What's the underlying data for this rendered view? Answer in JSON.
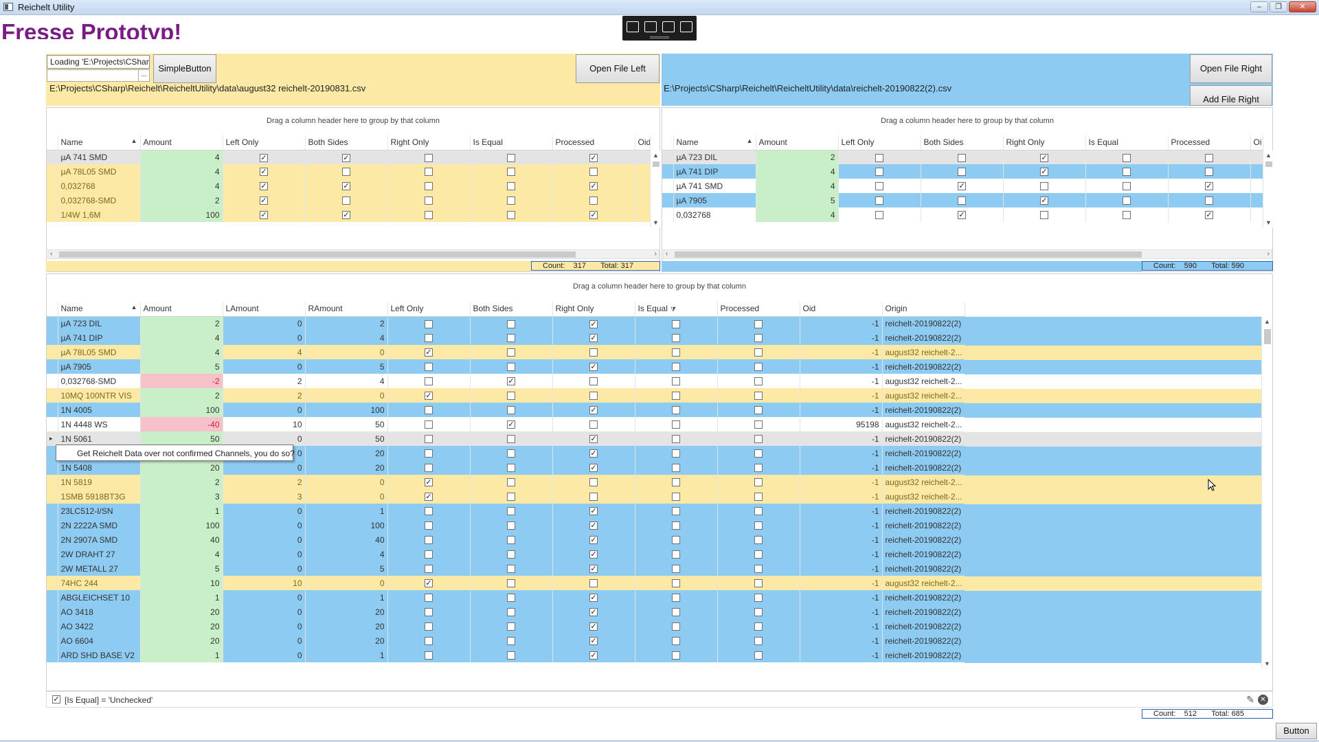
{
  "window": {
    "title": "Reichelt Utility"
  },
  "heading": "Fresse  Prototyp!",
  "left_panel": {
    "loading_text": "Loading 'E:\\Projects\\CSharp",
    "ellipsis": "...",
    "simple_button": "SimpleButton",
    "open_button": "Open File Left",
    "path": "E:\\Projects\\CSharp\\Reichelt\\ReicheltUtility\\data\\august32 reichelt-20190831.csv"
  },
  "right_panel": {
    "open_button": "Open File Right",
    "add_button": "Add File Right",
    "path": "E:\\Projects\\CSharp\\Reichelt\\ReicheltUtility\\data\\reichelt-20190822(2).csv"
  },
  "group_hint": "Drag a column header here to group by that column",
  "left_grid": {
    "columns": [
      "Name",
      "Amount",
      "Left Only",
      "Both Sides",
      "Right Only",
      "Is Equal",
      "Processed",
      "Oid"
    ],
    "rows": [
      {
        "name": "µA 741 SMD",
        "amount": "4",
        "lo": true,
        "bs": true,
        "ro": false,
        "eq": false,
        "pr": true
      },
      {
        "name": "µA 78L05 SMD",
        "amount": "4",
        "lo": true,
        "bs": false,
        "ro": false,
        "eq": false,
        "pr": false
      },
      {
        "name": "0,032768",
        "amount": "4",
        "lo": true,
        "bs": true,
        "ro": false,
        "eq": false,
        "pr": true
      },
      {
        "name": "0,032768-SMD",
        "amount": "2",
        "lo": true,
        "bs": false,
        "ro": false,
        "eq": false,
        "pr": false
      },
      {
        "name": "1/4W 1,6M",
        "amount": "100",
        "lo": true,
        "bs": true,
        "ro": false,
        "eq": false,
        "pr": true
      }
    ],
    "count_label": "Count:",
    "count": "317",
    "total_label": "Total:",
    "total": "317"
  },
  "right_grid": {
    "columns": [
      "Name",
      "Amount",
      "Left Only",
      "Both Sides",
      "Right Only",
      "Is Equal",
      "Processed",
      "Oi"
    ],
    "rows": [
      {
        "name": "µA 723 DIL",
        "amount": "2",
        "lo": false,
        "bs": false,
        "ro": true,
        "eq": false,
        "pr": false,
        "style": "w"
      },
      {
        "name": "µA 741 DIP",
        "amount": "4",
        "lo": false,
        "bs": false,
        "ro": true,
        "eq": false,
        "pr": false,
        "style": "b"
      },
      {
        "name": "µA 741 SMD",
        "amount": "4",
        "lo": false,
        "bs": true,
        "ro": false,
        "eq": false,
        "pr": true,
        "style": "w"
      },
      {
        "name": "µA 7905",
        "amount": "5",
        "lo": false,
        "bs": false,
        "ro": true,
        "eq": false,
        "pr": false,
        "style": "b"
      },
      {
        "name": "0,032768",
        "amount": "4",
        "lo": false,
        "bs": true,
        "ro": false,
        "eq": false,
        "pr": true,
        "style": "w"
      }
    ],
    "count_label": "Count:",
    "count": "590",
    "total_label": "Total:",
    "total": "590"
  },
  "bottom_grid": {
    "columns": [
      "Name",
      "Amount",
      "LAmount",
      "RAmount",
      "Left Only",
      "Both Sides",
      "Right Only",
      "Is Equal",
      "Processed",
      "Oid",
      "Origin"
    ],
    "rows": [
      {
        "name": "µA 723 DIL",
        "amount": "2",
        "la": "0",
        "ra": "2",
        "lo": false,
        "bs": false,
        "ro": true,
        "oid": "-1",
        "origin": "reichelt-20190822(2)",
        "style": "b",
        "amt": "g"
      },
      {
        "name": "µA 741 DIP",
        "amount": "4",
        "la": "0",
        "ra": "4",
        "lo": false,
        "bs": false,
        "ro": true,
        "oid": "-1",
        "origin": "reichelt-20190822(2)",
        "style": "b",
        "amt": "g"
      },
      {
        "name": "µA 78L05 SMD",
        "amount": "4",
        "la": "4",
        "ra": "0",
        "lo": true,
        "bs": false,
        "ro": false,
        "oid": "-1",
        "origin": "august32 reichelt-2...",
        "style": "y",
        "amt": "g"
      },
      {
        "name": "µA 7905",
        "amount": "5",
        "la": "0",
        "ra": "5",
        "lo": false,
        "bs": false,
        "ro": true,
        "oid": "-1",
        "origin": "reichelt-20190822(2)",
        "style": "b",
        "amt": "g"
      },
      {
        "name": "0,032768-SMD",
        "amount": "-2",
        "la": "2",
        "ra": "4",
        "lo": false,
        "bs": true,
        "ro": false,
        "oid": "-1",
        "origin": "august32 reichelt-2...",
        "style": "w",
        "amt": "r"
      },
      {
        "name": "10MQ 100NTR VIS",
        "amount": "2",
        "la": "2",
        "ra": "0",
        "lo": true,
        "bs": false,
        "ro": false,
        "oid": "-1",
        "origin": "august32 reichelt-2...",
        "style": "y",
        "amt": "g"
      },
      {
        "name": "1N 4005",
        "amount": "100",
        "la": "0",
        "ra": "100",
        "lo": false,
        "bs": false,
        "ro": true,
        "oid": "-1",
        "origin": "reichelt-20190822(2)",
        "style": "b",
        "amt": "g"
      },
      {
        "name": "1N 4448 WS",
        "amount": "-40",
        "la": "10",
        "ra": "50",
        "lo": false,
        "bs": true,
        "ro": false,
        "oid": "95198",
        "origin": "august32 reichelt-2...",
        "style": "w",
        "amt": "r"
      },
      {
        "name": "1N 5061",
        "amount": "50",
        "la": "0",
        "ra": "50",
        "lo": false,
        "bs": false,
        "ro": true,
        "oid": "-1",
        "origin": "reichelt-20190822(2)",
        "style": "g",
        "amt": "g"
      },
      {
        "name": "",
        "amount": "",
        "la": "0",
        "ra": "20",
        "lo": false,
        "bs": false,
        "ro": true,
        "oid": "-1",
        "origin": "reichelt-20190822(2)",
        "style": "b",
        "amt": "g"
      },
      {
        "name": "1N 5408",
        "amount": "20",
        "la": "0",
        "ra": "20",
        "lo": false,
        "bs": false,
        "ro": true,
        "oid": "-1",
        "origin": "reichelt-20190822(2)",
        "style": "b",
        "amt": "g"
      },
      {
        "name": "1N 5819",
        "amount": "2",
        "la": "2",
        "ra": "0",
        "lo": true,
        "bs": false,
        "ro": false,
        "oid": "-1",
        "origin": "august32 reichelt-2...",
        "style": "y",
        "amt": "g"
      },
      {
        "name": "1SMB 5918BT3G",
        "amount": "3",
        "la": "3",
        "ra": "0",
        "lo": true,
        "bs": false,
        "ro": false,
        "oid": "-1",
        "origin": "august32 reichelt-2...",
        "style": "y",
        "amt": "g"
      },
      {
        "name": "23LC512-I/SN",
        "amount": "1",
        "la": "0",
        "ra": "1",
        "lo": false,
        "bs": false,
        "ro": true,
        "oid": "-1",
        "origin": "reichelt-20190822(2)",
        "style": "b",
        "amt": "g"
      },
      {
        "name": "2N 2222A SMD",
        "amount": "100",
        "la": "0",
        "ra": "100",
        "lo": false,
        "bs": false,
        "ro": true,
        "oid": "-1",
        "origin": "reichelt-20190822(2)",
        "style": "b",
        "amt": "g"
      },
      {
        "name": "2N 2907A SMD",
        "amount": "40",
        "la": "0",
        "ra": "40",
        "lo": false,
        "bs": false,
        "ro": true,
        "oid": "-1",
        "origin": "reichelt-20190822(2)",
        "style": "b",
        "amt": "g"
      },
      {
        "name": "2W DRAHT 27",
        "amount": "4",
        "la": "0",
        "ra": "4",
        "lo": false,
        "bs": false,
        "ro": true,
        "oid": "-1",
        "origin": "reichelt-20190822(2)",
        "style": "b",
        "amt": "g"
      },
      {
        "name": "2W METALL 27",
        "amount": "5",
        "la": "0",
        "ra": "5",
        "lo": false,
        "bs": false,
        "ro": true,
        "oid": "-1",
        "origin": "reichelt-20190822(2)",
        "style": "b",
        "amt": "g"
      },
      {
        "name": "74HC 244",
        "amount": "10",
        "la": "10",
        "ra": "0",
        "lo": true,
        "bs": false,
        "ro": false,
        "oid": "-1",
        "origin": "august32 reichelt-2...",
        "style": "y",
        "amt": "g"
      },
      {
        "name": "ABGLEICHSET 10",
        "amount": "1",
        "la": "0",
        "ra": "1",
        "lo": false,
        "bs": false,
        "ro": true,
        "oid": "-1",
        "origin": "reichelt-20190822(2)",
        "style": "b",
        "amt": "g"
      },
      {
        "name": "AO 3418",
        "amount": "20",
        "la": "0",
        "ra": "20",
        "lo": false,
        "bs": false,
        "ro": true,
        "oid": "-1",
        "origin": "reichelt-20190822(2)",
        "style": "b",
        "amt": "g"
      },
      {
        "name": "AO 3422",
        "amount": "20",
        "la": "0",
        "ra": "20",
        "lo": false,
        "bs": false,
        "ro": true,
        "oid": "-1",
        "origin": "reichelt-20190822(2)",
        "style": "b",
        "amt": "g"
      },
      {
        "name": "AO 6604",
        "amount": "20",
        "la": "0",
        "ra": "20",
        "lo": false,
        "bs": false,
        "ro": true,
        "oid": "-1",
        "origin": "reichelt-20190822(2)",
        "style": "b",
        "amt": "g"
      },
      {
        "name": "ARD SHD BASE V2",
        "amount": "1",
        "la": "0",
        "ra": "1",
        "lo": false,
        "bs": false,
        "ro": true,
        "oid": "-1",
        "origin": "reichelt-20190822(2)",
        "style": "b",
        "amt": "g"
      }
    ],
    "count_label": "Count:",
    "count": "512",
    "total_label": "Total:",
    "total": "685"
  },
  "tooltip": "Get Reichelt Data over not confirmed Channels, you do so?",
  "filter": {
    "text": "[Is Equal] = 'Unchecked'",
    "checked": true
  },
  "bottom_button": "Button",
  "colors": {
    "left": "#fce9a6",
    "right": "#8dcbf3",
    "amount_positive": "#c9efc9",
    "amount_negative": "#f7c1c9",
    "heading": "#7a1c86"
  }
}
